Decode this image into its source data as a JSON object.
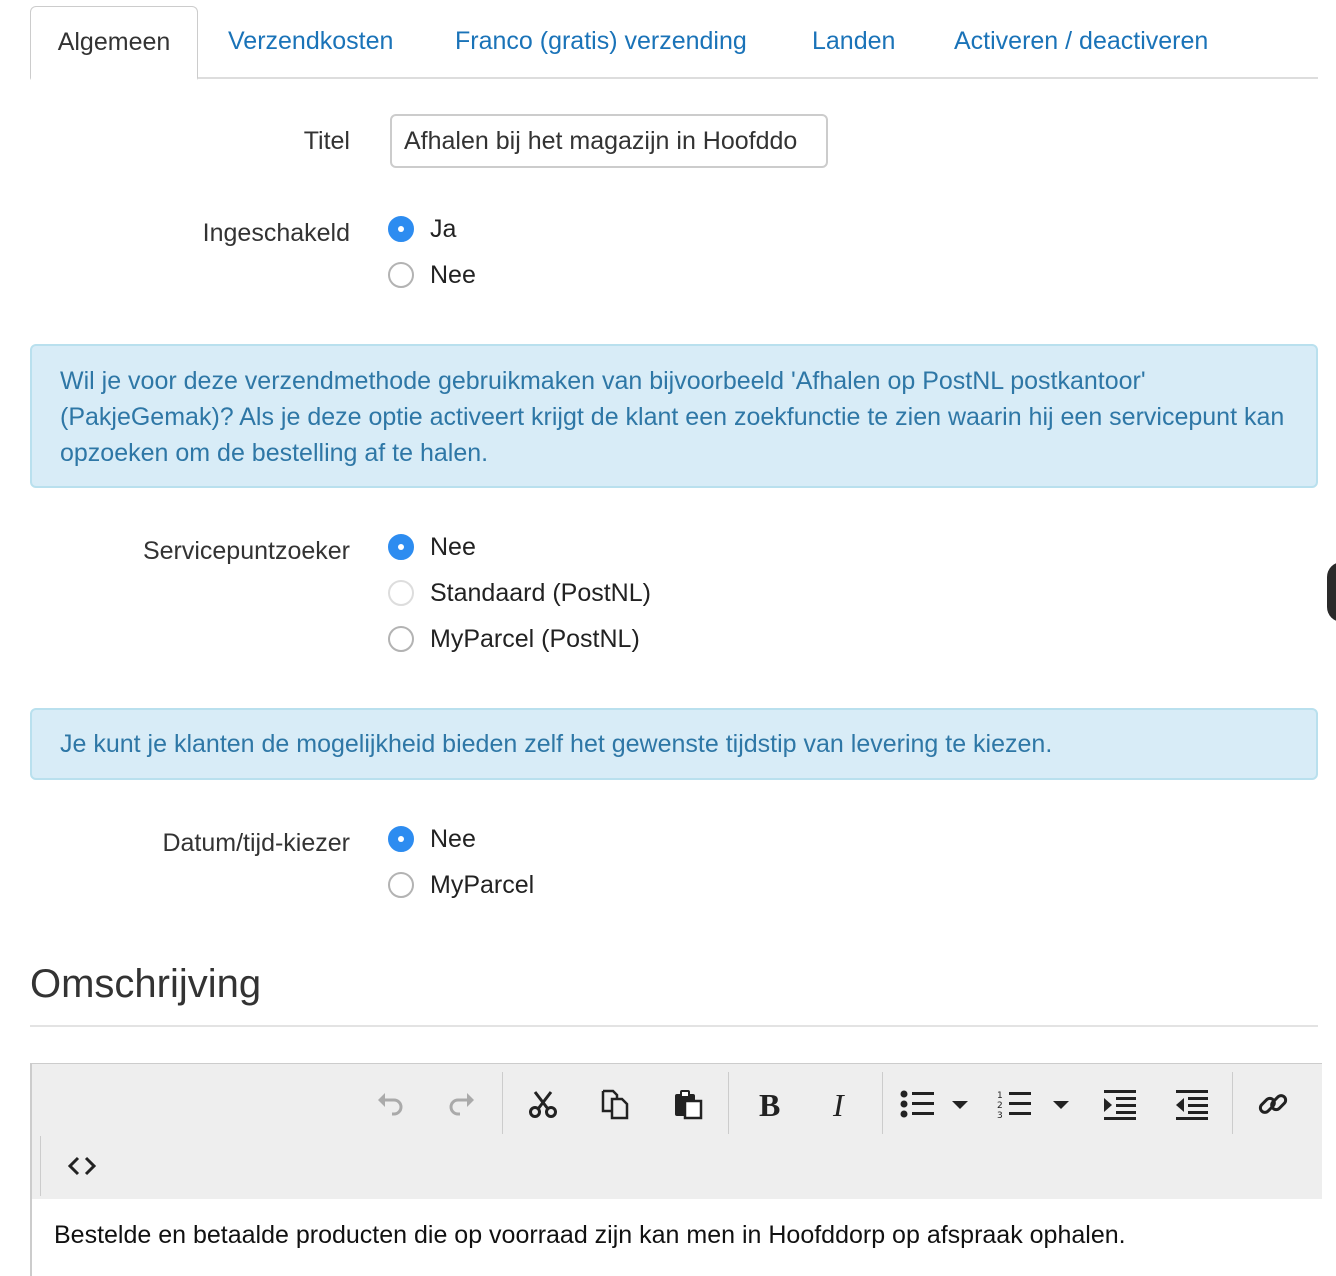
{
  "tabs": [
    {
      "label": "Algemeen",
      "active": true
    },
    {
      "label": "Verzendkosten"
    },
    {
      "label": "Franco (gratis) verzending"
    },
    {
      "label": "Landen"
    },
    {
      "label": "Activeren / deactiveren"
    }
  ],
  "form": {
    "title_label": "Titel",
    "title_value": "Afhalen bij het magazijn in Hoofddo",
    "enabled": {
      "label": "Ingeschakeld",
      "options": [
        {
          "label": "Ja",
          "checked": true
        },
        {
          "label": "Nee",
          "checked": false
        }
      ]
    },
    "info_servicepoint": "Wil je voor deze verzendmethode gebruikmaken van bijvoorbeeld 'Afhalen op PostNL postkantoor' (PakjeGemak)? Als je deze optie activeert krijgt de klant een zoekfunctie te zien waarin hij een servicepunt kan opzoeken om de bestelling af te halen.",
    "servicepoint": {
      "label": "Servicepuntzoeker",
      "options": [
        {
          "label": "Nee",
          "checked": true
        },
        {
          "label": "Standaard (PostNL)",
          "checked": false
        },
        {
          "label": "MyParcel (PostNL)",
          "checked": false
        }
      ]
    },
    "info_datetime": "Je kunt je klanten de mogelijkheid bieden zelf het gewenste tijdstip van levering te kiezen.",
    "datetime": {
      "label": "Datum/tijd-kiezer",
      "options": [
        {
          "label": "Nee",
          "checked": true
        },
        {
          "label": "MyParcel",
          "checked": false
        }
      ]
    }
  },
  "description": {
    "heading": "Omschrijving",
    "editor_text": "Bestelde en betaalde producten die op voorraad zijn kan men in Hoofddorp op afspraak ophalen.",
    "toolbar_icons": [
      "undo-icon",
      "redo-icon",
      "cut-icon",
      "copy-icon",
      "paste-icon",
      "bold-icon",
      "italic-icon",
      "bulleted-list-icon",
      "numbered-list-icon",
      "outdent-icon",
      "indent-icon",
      "link-icon",
      "source-code-icon"
    ]
  },
  "colors": {
    "accent": "#2d8cf0",
    "link": "#1a73b8",
    "info_bg": "#d8ecf7",
    "info_text": "#2e77a6"
  }
}
